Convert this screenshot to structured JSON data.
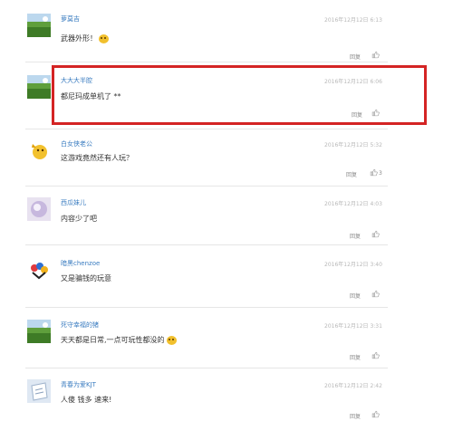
{
  "comments": [
    {
      "user": "萝莫吉",
      "time": "2016年12月12日 6:13",
      "text": "武器外形！",
      "emoji": true,
      "reply": "回复",
      "likes": "",
      "avatar": "green-field"
    },
    {
      "user": "大大大半腔",
      "time": "2016年12月12日 6:06",
      "text": "都尼玛成单机了 **",
      "emoji": false,
      "reply": "回复",
      "likes": "",
      "avatar": "green-field"
    },
    {
      "user": "白女侠老公",
      "time": "2016年12月12日 5:32",
      "text": "这游戏竟然还有人玩？",
      "emoji": false,
      "reply": "回复",
      "likes": "3",
      "avatar": "yellow-character"
    },
    {
      "user": "西瓜妹儿",
      "time": "2016年12月12日 4:03",
      "text": "内容少了吧",
      "emoji": false,
      "reply": "回复",
      "likes": "",
      "avatar": "lavender-blur"
    },
    {
      "user": "暗黑chenzoe",
      "time": "2016年12月12日 3:40",
      "text": "又是骗钱的玩意",
      "emoji": false,
      "reply": "回复",
      "likes": "",
      "avatar": "colorful-logo"
    },
    {
      "user": "死守幸福的猪",
      "time": "2016年12月12日 3:31",
      "text": "天天都是日常,一点可玩性都没的",
      "emoji": true,
      "reply": "回复",
      "likes": "",
      "avatar": "green-field"
    },
    {
      "user": "青春为爱KJT",
      "time": "2016年12月12日 2:42",
      "text": "人傻 钱多 速来!",
      "emoji": false,
      "reply": "回复",
      "likes": "",
      "avatar": "paper-photo"
    }
  ],
  "highlighted_comment_index": 1,
  "colors": {
    "highlight": "#d42424",
    "username": "#3a7cc0"
  },
  "icons": {
    "like": "thumbs-up-icon"
  }
}
